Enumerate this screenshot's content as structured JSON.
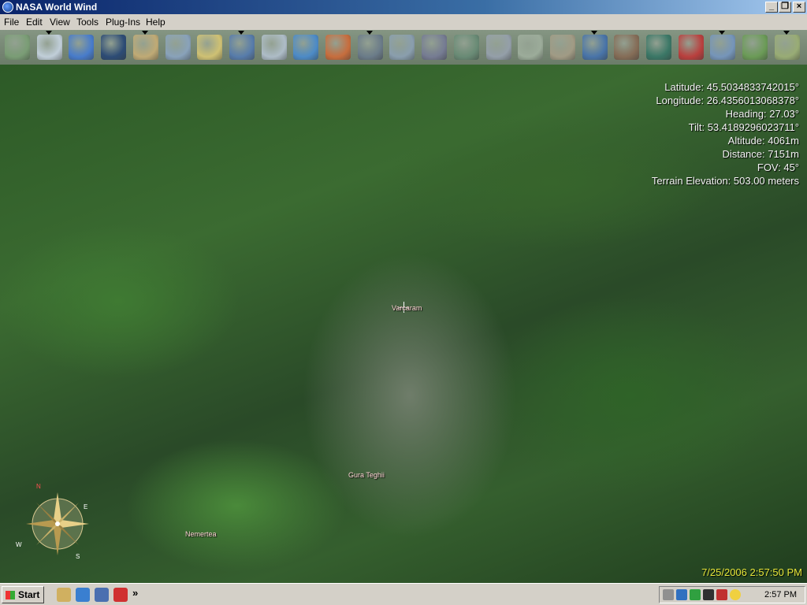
{
  "window": {
    "title": "NASA World Wind"
  },
  "menubar": {
    "items": [
      "File",
      "Edit",
      "View",
      "Tools",
      "Plug-Ins",
      "Help"
    ]
  },
  "toolbar": {
    "tools": [
      {
        "name": "layers-icon",
        "color": "#7fa27a"
      },
      {
        "name": "grid-icon",
        "color": "#c9d6e3"
      },
      {
        "name": "globe-icon",
        "color": "#4a7fd4"
      },
      {
        "name": "earth-dark-icon",
        "color": "#2e4d7a"
      },
      {
        "name": "compass-icon",
        "color": "#c8b07a"
      },
      {
        "name": "clouds-icon",
        "color": "#8ea7c2"
      },
      {
        "name": "search-icon",
        "color": "#d8c878"
      },
      {
        "name": "earth-globe-icon",
        "color": "#5a7fb2"
      },
      {
        "name": "landsat-icon",
        "color": "#b5c3d0"
      },
      {
        "name": "wms-icon",
        "color": "#4f8fd0"
      },
      {
        "name": "temperature-icon",
        "color": "#d07040"
      },
      {
        "name": "usgs-ortho-icon",
        "color": "#6f7f8f"
      },
      {
        "name": "usgs-topo-icon",
        "color": "#8fa3b5"
      },
      {
        "name": "usgs-urban-icon",
        "color": "#7a7f99"
      },
      {
        "name": "usgs-map-icon",
        "color": "#6d8f7a"
      },
      {
        "name": "terra-icon",
        "color": "#9aa4b0"
      },
      {
        "name": "usgs-scan-icon",
        "color": "#a2b2a0"
      },
      {
        "name": "usgs-relief-icon",
        "color": "#a8a08a"
      },
      {
        "name": "zoom-globe-icon",
        "color": "#4b77b0"
      },
      {
        "name": "placenames-icon",
        "color": "#8a6f5a"
      },
      {
        "name": "boundaries-icon",
        "color": "#3c7a6a"
      },
      {
        "name": "flags-icon",
        "color": "#c24040"
      },
      {
        "name": "map-icon",
        "color": "#7a9ac2"
      },
      {
        "name": "us-map-icon",
        "color": "#6fa05a"
      },
      {
        "name": "satellite-icon",
        "color": "#9fb27a"
      }
    ]
  },
  "overlay": {
    "lines": [
      "Latitude: 45.5034833742015°",
      "Longitude: 26.4356013068378°",
      "Heading: 27.03°",
      "Tilt: 53.4189296023711°",
      "Altitude: 4061m",
      "Distance: 7151m",
      "FOV: 45°",
      "Terrain Elevation: 503.00 meters"
    ],
    "placenames": [
      "Varcaram",
      "Gura Teghii",
      "Nemertea"
    ],
    "timestamp": "7/25/2006 2:57:50 PM",
    "compass_labels": [
      "N",
      "E",
      "S",
      "W"
    ]
  },
  "taskbar": {
    "start_label": "Start",
    "chevron": "»",
    "clock": "2:57 PM",
    "quick_launch": [
      "show-desktop-icon",
      "internet-explorer-icon",
      "outlook-icon",
      "opera-icon"
    ],
    "tray_icons": [
      "volume-icon",
      "3d-icon",
      "network-icon",
      "camera-icon",
      "antivirus-icon",
      "messenger-icon",
      "smiley-icon"
    ]
  }
}
